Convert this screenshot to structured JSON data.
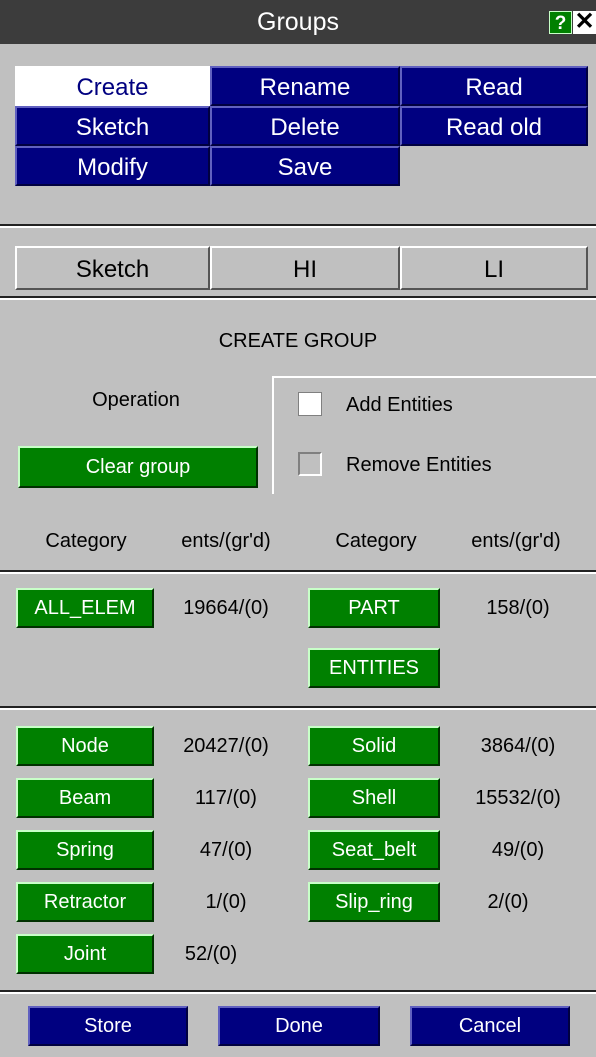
{
  "window": {
    "title": "Groups",
    "help_label": "?",
    "close_label": "✕"
  },
  "tabs": [
    "Create",
    "Rename",
    "Read",
    "Sketch",
    "Delete",
    "Read old",
    "Modify",
    "Save"
  ],
  "sub_tabs": [
    "Sketch",
    "HI",
    "LI"
  ],
  "panel": {
    "heading": "CREATE GROUP",
    "operation_label": "Operation",
    "clear_group_label": "Clear group",
    "add_entities_label": "Add Entities",
    "remove_entities_label": "Remove Entities",
    "add_entities_checked": true,
    "remove_entities_checked": false
  },
  "columns": {
    "category": "Category",
    "ents": "ents/(gr'd)"
  },
  "top_rows": {
    "all_elem": {
      "label": "ALL_ELEM",
      "value": "19664/(0)"
    },
    "part": {
      "label": "PART",
      "value": "158/(0)"
    },
    "entities": {
      "label": "ENTITIES"
    }
  },
  "entity_rows": {
    "left": [
      {
        "label": "Node",
        "value": "20427/(0)"
      },
      {
        "label": "Beam",
        "value": "117/(0)"
      },
      {
        "label": "Spring",
        "value": "47/(0)"
      },
      {
        "label": "Retractor",
        "value": "1/(0)"
      },
      {
        "label": "Joint",
        "value": "52/(0)"
      }
    ],
    "right": [
      {
        "label": "Solid",
        "value": "3864/(0)"
      },
      {
        "label": "Shell",
        "value": "15532/(0)"
      },
      {
        "label": "Seat_belt",
        "value": "49/(0)"
      },
      {
        "label": "Slip_ring",
        "value": "2/(0)"
      }
    ]
  },
  "footer": {
    "store": "Store",
    "done": "Done",
    "cancel": "Cancel"
  },
  "colors": {
    "title_bar": "#3c3c3c",
    "tab_blue": "#000080",
    "button_green": "#008000",
    "panel_grey": "#c0c0c0"
  }
}
